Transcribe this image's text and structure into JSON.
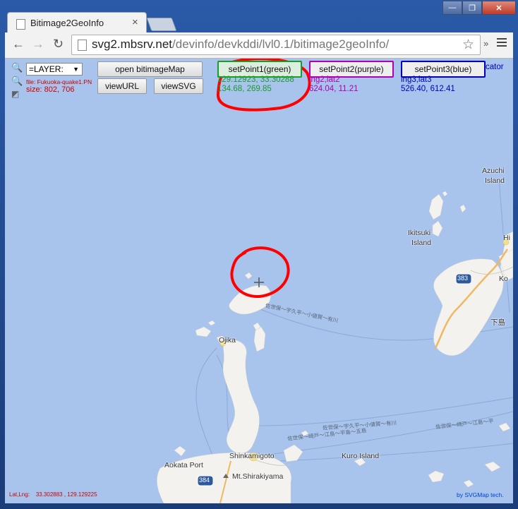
{
  "browser": {
    "tab_title": "Bitimage2GeoInfo",
    "tab_close": "×",
    "url_host": "svg2.mbsrv.net",
    "url_path": "/devinfo/devkddi/lvl0.1/bitimage2geoInfo/",
    "back": "←",
    "forward": "→",
    "reload": "↻",
    "bookmark_star": "☆",
    "extensions": "»",
    "win_min": "—",
    "win_max": "❐",
    "win_close": "✕"
  },
  "controls": {
    "layer_select": "=LAYER:",
    "open_button": "open bitimageMap",
    "view_url_button": "viewURL",
    "view_svg_button": "viewSVG",
    "file_name": "file: Fukuoka-quake1.PN",
    "size_text": "size: 802, 706",
    "set_point1_button": "setPoint1(green)",
    "set_point2_button": "setPoint2(purple)",
    "set_point3_button": "setPoint3(blue)",
    "point1_latlng": "129.12923, 33.30288",
    "point1_xy": "134.68, 269.85",
    "point2_latlng": "lng2,lat2",
    "point2_xy": "624.04, 11.21",
    "point3_latlng": "lng3,lat3",
    "point3_xy": "526.40, 612.41",
    "projection_fragment": "cator"
  },
  "map": {
    "labels": {
      "azuchi": "Azuchi",
      "island1": "Island",
      "ikitsuki": "Ikitsuki",
      "island2": "Island",
      "hi": "Hi",
      "ko": "Ko",
      "shimo": "下島",
      "oji": "Ojika",
      "shinkamigoto": "Shinkamigoto",
      "aokata": "Aokata Port",
      "kuro": "Kuro Island",
      "shirakiyama": "Mt.Shirakiyama",
      "route383": "383",
      "route384": "384",
      "ferry1": "佐世保～宇久平～小値賀～有川",
      "ferry2": "佐世保～宇久平～小値賀～有川",
      "ferry3": "佐世保～崎戸～江島～平島～五島",
      "ferry4": "佐世保～崎戸～江島～平"
    }
  },
  "status": {
    "latlng_label": "Lat,Lng:",
    "latlng_value": "33.302883 , 129.129225",
    "credit": "by SVGMap tech."
  },
  "colors": {
    "green": "#1a9c2a",
    "purple": "#b000b0",
    "blue": "#0000c0",
    "red_annotation": "#ff0000",
    "sea": "#a8c3ec"
  }
}
